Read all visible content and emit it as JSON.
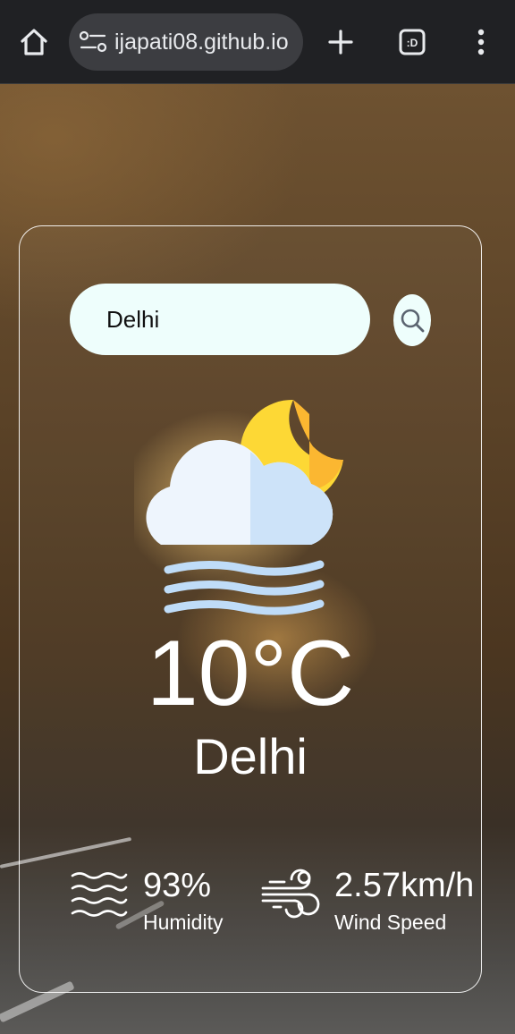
{
  "browser": {
    "url": "ijapati08.github.io",
    "icons": [
      "home-icon",
      "site-settings-icon",
      "new-tab-icon",
      "tab-switcher-icon",
      "more-menu-icon"
    ],
    "tab_switcher_label": ":D"
  },
  "weather": {
    "search": {
      "value": "Delhi",
      "placeholder": ""
    },
    "search_icon": "search-icon",
    "condition_icon": "mist-night-icon",
    "temperature": "10°C",
    "city": "Delhi",
    "humidity": {
      "value": "93%",
      "label": "Humidity",
      "icon": "humidity-icon"
    },
    "wind": {
      "value": "2.57km/h",
      "label": "Wind Speed",
      "icon": "wind-icon"
    }
  },
  "colors": {
    "chrome_bg": "#202124",
    "omnibox_bg": "#3c3d41",
    "input_bg": "#eefefc",
    "moon": "#fdd835",
    "moon_shade": "#fbb731",
    "cloud": "#eef5fd",
    "cloud_shade": "#cde3f9",
    "mist": "#bfdcf8",
    "text": "#ffffff"
  }
}
